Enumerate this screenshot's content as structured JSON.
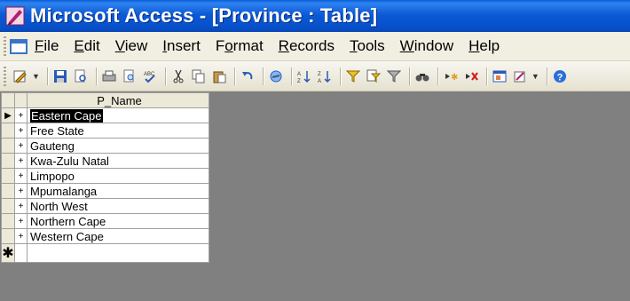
{
  "window": {
    "title": "Microsoft Access - [Province : Table]",
    "title_color": "#0a55d4"
  },
  "menu": {
    "items": [
      {
        "underline": "F",
        "rest": "ile"
      },
      {
        "underline": "E",
        "rest": "dit"
      },
      {
        "underline": "V",
        "rest": "iew"
      },
      {
        "underline": "I",
        "rest": "nsert"
      },
      {
        "pre": "F",
        "underline": "o",
        "rest": "rmat"
      },
      {
        "underline": "R",
        "rest": "ecords"
      },
      {
        "underline": "T",
        "rest": "ools"
      },
      {
        "underline": "W",
        "rest": "indow"
      },
      {
        "underline": "H",
        "rest": "elp"
      }
    ]
  },
  "toolbar": {
    "icons": [
      "design-view-icon",
      "save-icon",
      "search-file-icon",
      "print-icon",
      "print-preview-icon",
      "spelling-icon",
      "cut-icon",
      "copy-icon",
      "paste-icon",
      "undo-icon",
      "insert-hyperlink-icon",
      "sort-ascending-icon",
      "sort-descending-icon",
      "filter-by-selection-icon",
      "filter-by-form-icon",
      "apply-filter-icon",
      "find-icon",
      "new-record-icon",
      "delete-record-icon",
      "database-window-icon",
      "new-object-icon",
      "help-icon"
    ]
  },
  "grid": {
    "column_header": "P_Name",
    "rows": [
      "Eastern Cape",
      "Free State",
      "Gauteng",
      "Kwa-Zulu Natal",
      "Limpopo",
      "Mpumalanga",
      "North West",
      "Northern Cape",
      "Western Cape"
    ],
    "expand_glyph": "+",
    "current_row_glyph": "▶",
    "new_row_glyph": "✱"
  }
}
